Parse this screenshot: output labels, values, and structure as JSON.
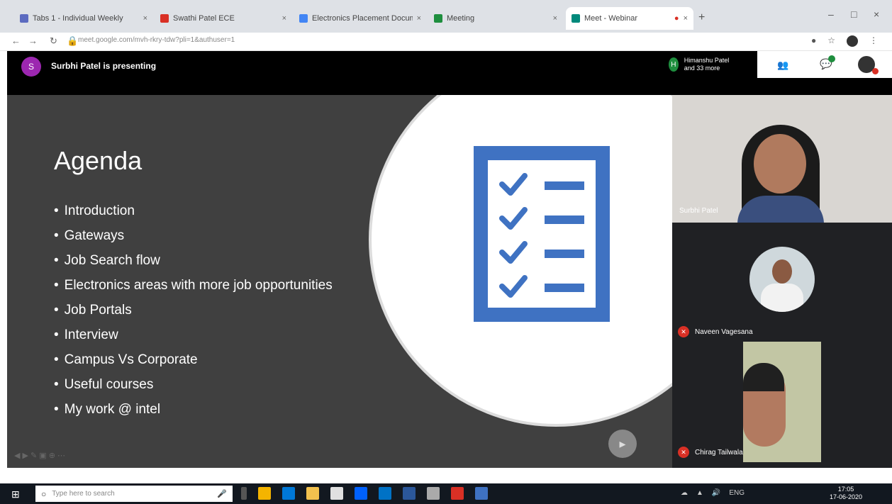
{
  "browser": {
    "tabs": [
      {
        "label": "Tabs 1 - Individual Weekly",
        "favicon": "#5c6bc0",
        "active": false
      },
      {
        "label": "Swathi Patel ECE",
        "favicon": "#d93025",
        "active": false
      },
      {
        "label": "Electronics Placement Document",
        "favicon": "#4285f4",
        "active": false
      },
      {
        "label": "Meeting",
        "favicon": "#1e8e3e",
        "active": false
      },
      {
        "label": "Meet - Webinar",
        "favicon": "#00897b",
        "active": true
      }
    ],
    "url": "meet.google.com/mvh-rkry-tdw?pli=1&authuser=1"
  },
  "meet": {
    "presenter_initial": "S",
    "presenter_text": "Surbhi Patel is presenting",
    "participants_chip": {
      "initial": "H",
      "text": "Himanshu Patel and 33 more"
    },
    "slide": {
      "title": "Agenda",
      "items": [
        "Introduction",
        "Gateways",
        "Job Search flow",
        "Electronics areas with more job opportunities",
        "Job Portals",
        "Interview",
        "Campus Vs Corporate",
        "Useful courses",
        "My work @ intel"
      ]
    },
    "participants": [
      {
        "name": "Surbhi Patel"
      },
      {
        "name": "Naveen Vagesana"
      },
      {
        "name": "Chirag Tailwala"
      }
    ]
  },
  "taskbar": {
    "search_placeholder": "Type here to search",
    "time": "17:05",
    "date": "17-06-2020"
  }
}
